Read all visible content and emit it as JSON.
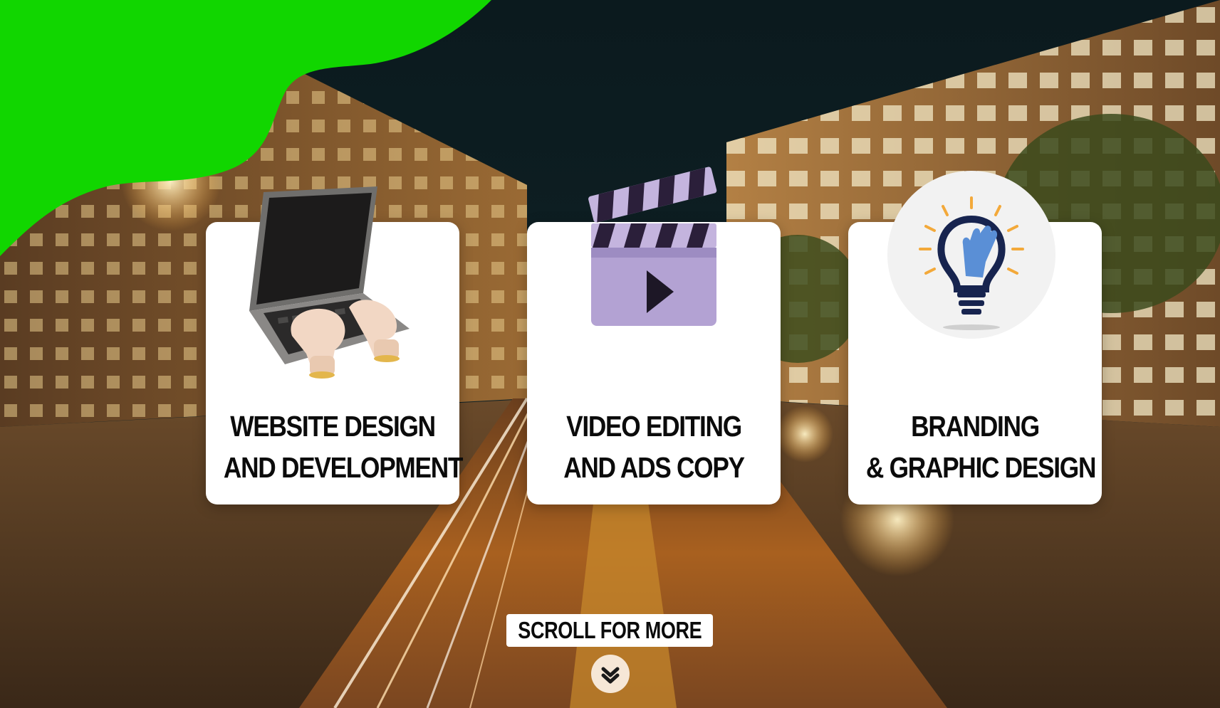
{
  "colors": {
    "accent_green": "#11d600",
    "card_bg": "#ffffff",
    "title_text": "#0b0b0b",
    "scroll_icon_bg": "#f6e7d6"
  },
  "services": [
    {
      "line1": "WEBSITE DESIGN",
      "line2": "AND DEVELOPMENT",
      "icon": "laptop-typing-icon"
    },
    {
      "line1": "VIDEO EDITING",
      "line2": "AND ADS COPY",
      "icon": "clapperboard-icon"
    },
    {
      "line1": "BRANDING",
      "line2": "& GRAPHIC DESIGN",
      "icon": "lightbulb-hand-icon"
    }
  ],
  "scroll": {
    "label": "SCROLL FOR MORE",
    "icon": "double-chevron-down-icon"
  }
}
